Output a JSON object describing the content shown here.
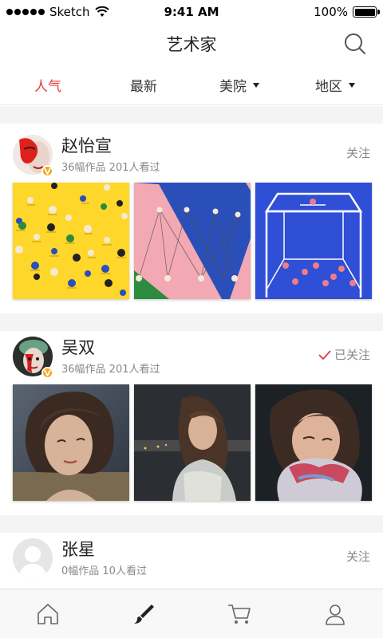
{
  "status_bar": {
    "carrier": "Sketch",
    "time": "9:41 AM",
    "battery": "100%"
  },
  "nav": {
    "title": "艺术家"
  },
  "tabs": [
    {
      "label": "人气",
      "active": true,
      "dropdown": false
    },
    {
      "label": "最新",
      "active": false,
      "dropdown": false
    },
    {
      "label": "美院",
      "active": false,
      "dropdown": true
    },
    {
      "label": "地区",
      "active": false,
      "dropdown": true
    }
  ],
  "artists": [
    {
      "name": "赵怡宣",
      "meta": "36幅作品 201人看过",
      "follow_label": "关注",
      "followed": false,
      "verified": true
    },
    {
      "name": "吴双",
      "meta": "36幅作品 201人看过",
      "follow_label": "已关注",
      "followed": true,
      "verified": true
    },
    {
      "name": "张星",
      "meta": "0幅作品 10人看过",
      "follow_label": "关注",
      "followed": false,
      "verified": false
    }
  ],
  "bottom_tabs": [
    {
      "icon": "home-icon",
      "active": false
    },
    {
      "icon": "brush-icon",
      "active": true
    },
    {
      "icon": "cart-icon",
      "active": false
    },
    {
      "icon": "profile-icon",
      "active": false
    }
  ],
  "colors": {
    "accent": "#e83a3a",
    "badge": "#f5a623",
    "muted_text": "#888888",
    "page_gap": "#f4f4f4"
  }
}
